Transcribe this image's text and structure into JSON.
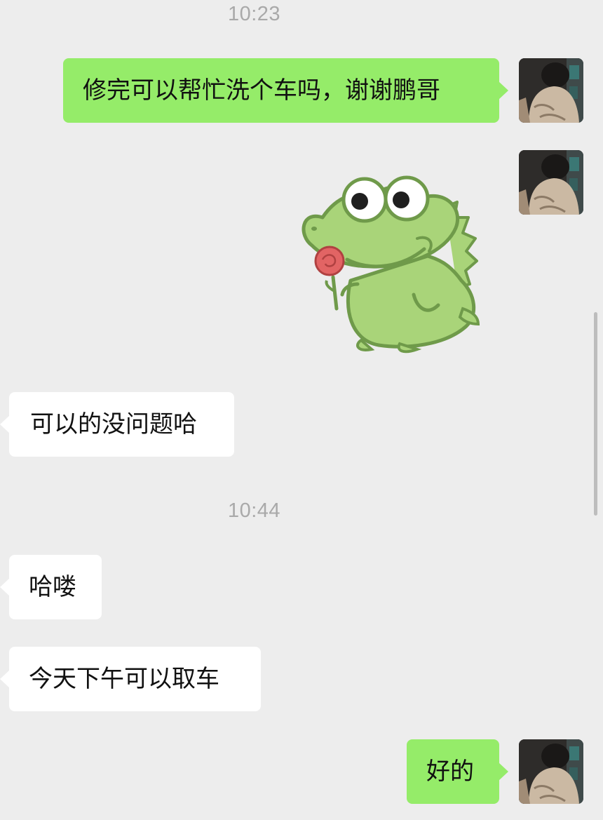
{
  "conversation": {
    "timestamps": [
      "10:23",
      "10:44"
    ],
    "messages": [
      {
        "direction": "sent",
        "type": "text",
        "text": "修完可以帮忙洗个车吗，谢谢鹏哥"
      },
      {
        "direction": "sent",
        "type": "sticker",
        "sticker": "green-dinosaur-holding-rose"
      },
      {
        "direction": "received",
        "type": "text",
        "text": "可以的没问题哈"
      },
      {
        "direction": "received",
        "type": "text",
        "text": "哈喽"
      },
      {
        "direction": "received",
        "type": "text",
        "text": "今天下午可以取车"
      },
      {
        "direction": "sent",
        "type": "text",
        "text": "好的"
      }
    ]
  },
  "colors": {
    "background": "#ededed",
    "sent_bubble": "#95ec69",
    "received_bubble": "#ffffff",
    "timestamp_text": "#a9a9a9"
  },
  "icons": {
    "avatar": "user-avatar-photo",
    "sticker": "green-dinosaur-sticker"
  }
}
